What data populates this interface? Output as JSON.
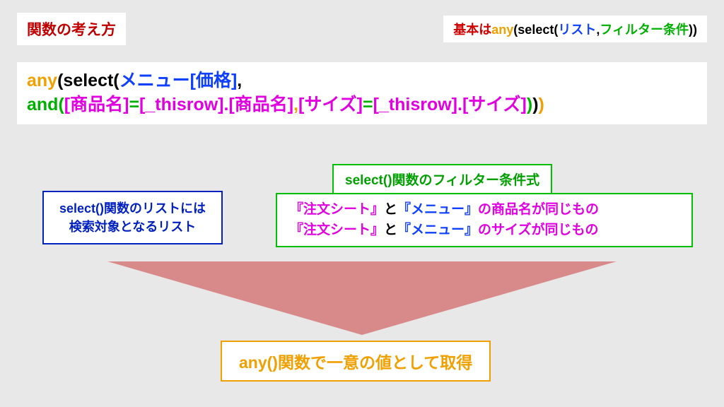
{
  "title": "関数の考え方",
  "top_right": {
    "prefix": "基本は",
    "any": "any",
    "paren_open": "(",
    "select": "select",
    "paren_open2": "(",
    "list": "リスト",
    "comma": ",",
    "filter": "フィルター条件",
    "paren_close": "))"
  },
  "expr": {
    "l1_any": "any",
    "l1_p1": "(",
    "l1_select": "select(",
    "l1_menu": "メニュー[価格]",
    "l1_comma": ",",
    "l2_and": "and(",
    "l2_a1": "[商品名]",
    "l2_eq1": "=",
    "l2_a2": "[_thisrow].[商品名]",
    "l2_comma": ",",
    "l2_b1": "[サイズ]",
    "l2_eq2": "=",
    "l2_b2": "[_thisrow].[サイズ]",
    "l2_close_inner": ")",
    "l2_close_sel": ")",
    "l2_close_any": ")"
  },
  "left_box": {
    "line1": "select()関数のリストには",
    "line2": "検索対象となるリスト"
  },
  "right_label": "select()関数のフィルター条件式",
  "right_box": {
    "r1a": "『注文シート』",
    "r1b": "と",
    "r1c": "『メニュー』",
    "r1d": "の商品名が同じもの",
    "r2a": "『注文シート』",
    "r2b": "と",
    "r2c": "『メニュー』",
    "r2d": "のサイズが同じもの"
  },
  "bottom_box": "any()関数で一意の値として取得"
}
